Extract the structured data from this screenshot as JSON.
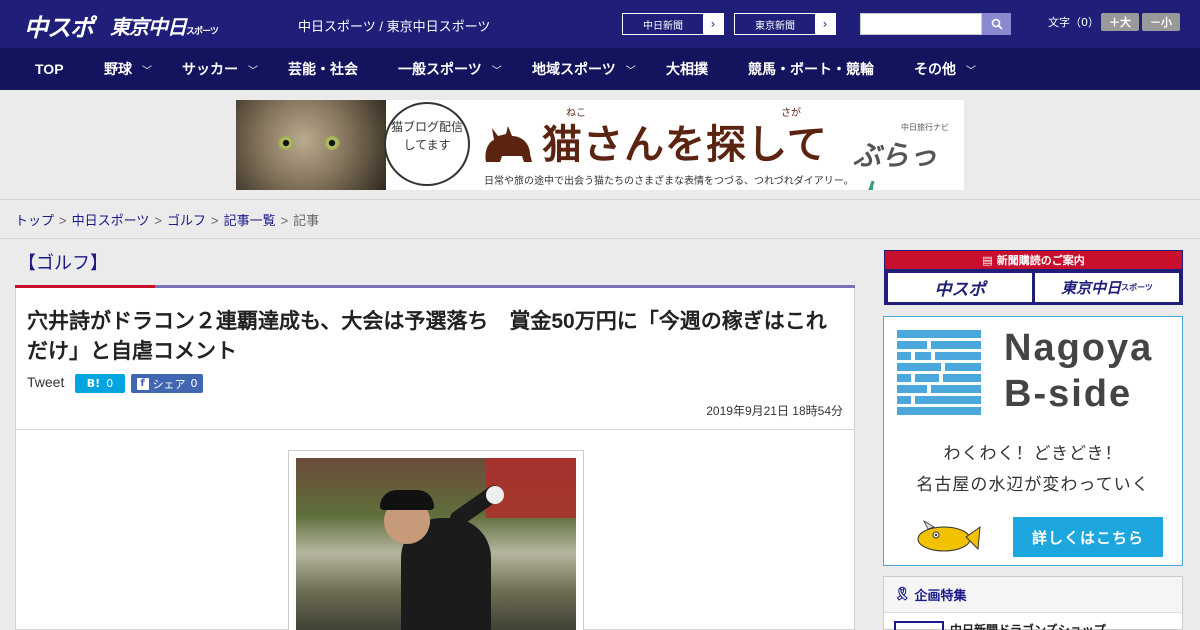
{
  "header": {
    "logo_chuspo": "中スポ",
    "logo_tokyo": "東京中日",
    "logo_tokyo_small": "スポーツ",
    "site_name": "中日スポーツ / 東京中日スポーツ",
    "paper_links": [
      {
        "label": "中日新聞"
      },
      {
        "label": "東京新聞"
      }
    ],
    "search_placeholder": "",
    "font_size_label": "文字（0）",
    "font_plus": "＋大",
    "font_minus": "－小"
  },
  "nav": {
    "items": [
      {
        "label": "TOP",
        "dropdown": false
      },
      {
        "label": "野球",
        "dropdown": true
      },
      {
        "label": "サッカー",
        "dropdown": true
      },
      {
        "label": "芸能・社会",
        "dropdown": false
      },
      {
        "label": "一般スポーツ",
        "dropdown": true
      },
      {
        "label": "地域スポーツ",
        "dropdown": true
      },
      {
        "label": "大相撲",
        "dropdown": false
      },
      {
        "label": "競馬・ボート・競輪",
        "dropdown": false
      },
      {
        "label": "その他",
        "dropdown": true
      }
    ]
  },
  "banner": {
    "bubble_text": "猫ブログ配信してます",
    "title": "猫さんを探して",
    "ruby_neko": "ねこ",
    "ruby_saga": "さが",
    "subtitle": "日常や旅の途中で出会う猫たちのさまざまな表情をつづる、つれづれダイアリー。",
    "brand_small": "中日旅行ナビ",
    "brand": "ぶらっ",
    "brand_accent": "人"
  },
  "breadcrumb": {
    "items": [
      "トップ",
      "中日スポーツ",
      "ゴルフ",
      "記事一覧"
    ],
    "current": "記事",
    "separator": ">"
  },
  "article": {
    "category": "【ゴルフ】",
    "headline": "穴井詩がドラコン２連覇達成も、大会は予選落ち　賞金50万円に「今週の稼ぎはこれだけ」と自虐コメント",
    "tweet_label": "Tweet",
    "hatena_label": "B!",
    "hatena_count": "0",
    "fb_label": "シェア",
    "fb_count": "0",
    "date": "2019年9月21日 18時54分"
  },
  "sidebar": {
    "subscribe_head": "新聞購読のご案内",
    "subscribe_logo1": "中スポ",
    "subscribe_logo2": "東京中日",
    "subscribe_logo2_small": "スポーツ",
    "ad_title_line1": "Nagoya",
    "ad_title_line2": "B-side",
    "ad_line1": "わくわく！どきどき！",
    "ad_line2": "名古屋の水辺が変わっていく",
    "ad_button": "詳しくはこちら",
    "feature_head": "企画特集",
    "feature_item": "中日新聞ドラゴンズショップ"
  },
  "colors": {
    "header_bg": "#1f1f7a",
    "nav_bg": "#14145e",
    "accent_red": "#c8102e",
    "accent_purple": "#7b6fb5",
    "ad_blue": "#1ea6de"
  }
}
